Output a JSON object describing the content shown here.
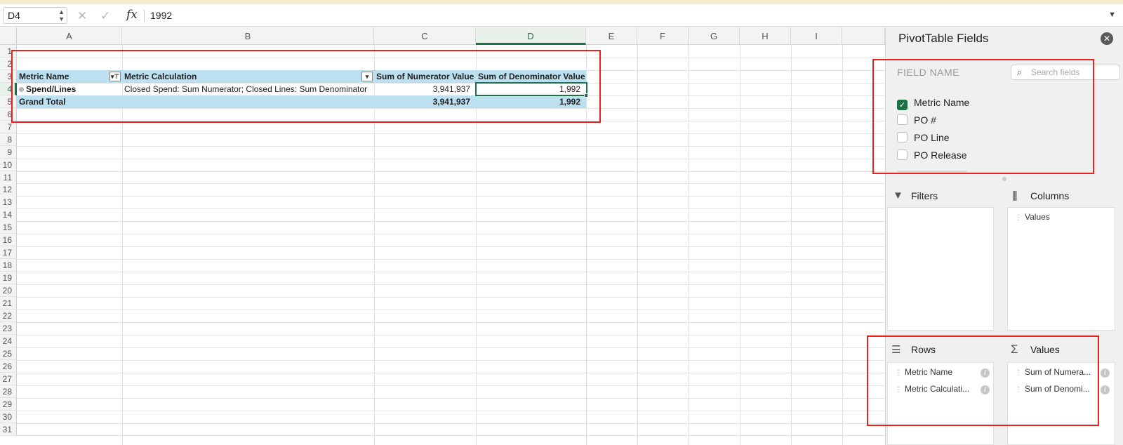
{
  "formula_bar": {
    "name_box": "D4",
    "formula_value": "1992"
  },
  "columns": [
    "A",
    "B",
    "C",
    "D",
    "E",
    "F",
    "G",
    "H",
    "I"
  ],
  "rows": [
    "1",
    "2",
    "3",
    "4",
    "5",
    "6",
    "7",
    "8",
    "9",
    "10",
    "11",
    "12",
    "13",
    "14",
    "15",
    "16",
    "17",
    "18",
    "19",
    "20",
    "21",
    "22",
    "23",
    "24",
    "25",
    "26",
    "27",
    "28",
    "29",
    "30",
    "31"
  ],
  "pivot": {
    "headers": {
      "metric_name": "Metric Name",
      "metric_calc": "Metric Calculation",
      "numerator": "Sum of Numerator Value",
      "denominator": "Sum of Denominator Value"
    },
    "row": {
      "metric_name": "Spend/Lines",
      "metric_calc": "Closed Spend: Sum Numerator; Closed Lines: Sum Denominator",
      "numerator": "3,941,937",
      "denominator": "1,992"
    },
    "total": {
      "label": "Grand Total",
      "numerator": "3,941,937",
      "denominator": "1,992"
    }
  },
  "pane": {
    "title": "PivotTable Fields",
    "field_name_label": "FIELD NAME",
    "search_placeholder": "Search fields",
    "fields": [
      {
        "label": "Metric Name",
        "checked": true
      },
      {
        "label": "PO #",
        "checked": false
      },
      {
        "label": "PO Line",
        "checked": false
      },
      {
        "label": "PO Release",
        "checked": false
      }
    ],
    "zones": {
      "filters": {
        "title": "Filters",
        "items": []
      },
      "columns": {
        "title": "Columns",
        "items": [
          "Values"
        ]
      },
      "rows": {
        "title": "Rows",
        "items": [
          "Metric Name",
          "Metric Calculati..."
        ]
      },
      "values": {
        "title": "Values",
        "items": [
          "Sum of Numera...",
          "Sum of Denomi..."
        ]
      }
    }
  },
  "icons": {
    "close": "close-icon",
    "search": "search-icon",
    "filter": "filter-icon",
    "columns": "columns-icon",
    "rows": "rows-icon",
    "values": "sigma-icon"
  },
  "accent_color": "#1e7145",
  "highlight_color": "#e5251d"
}
